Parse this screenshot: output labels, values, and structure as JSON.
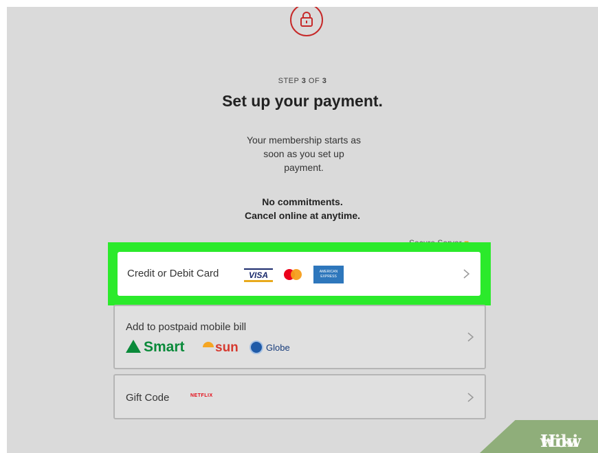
{
  "header": {
    "lock_icon": "lock-icon",
    "step_prefix": "STEP",
    "step_current": "3",
    "step_of": "OF",
    "step_total": "3",
    "title": "Set up your payment."
  },
  "description": {
    "line1": "Your membership starts as",
    "line2": "soon as you set up",
    "line3": "payment."
  },
  "commitments": {
    "line1": "No commitments.",
    "line2": "Cancel online at anytime."
  },
  "secure_server": {
    "label": "Secure Server",
    "icon": "padlock-icon"
  },
  "payment_options": {
    "card": {
      "label": "Credit or Debit Card",
      "visa": "VISA",
      "amex_line1": "AMERICAN",
      "amex_line2": "EXPRESS"
    },
    "mobile": {
      "label": "Add to postpaid mobile bill",
      "smart": "Smart",
      "sun": "sun",
      "globe": "Globe"
    },
    "gift": {
      "label": "Gift Code",
      "netflix": "NETFLIX"
    }
  },
  "watermark": {
    "wiki": "wiki",
    "how": "How"
  },
  "colors": {
    "highlight": "#2bea2b",
    "lock_red": "#c62828",
    "background": "#dadada"
  }
}
